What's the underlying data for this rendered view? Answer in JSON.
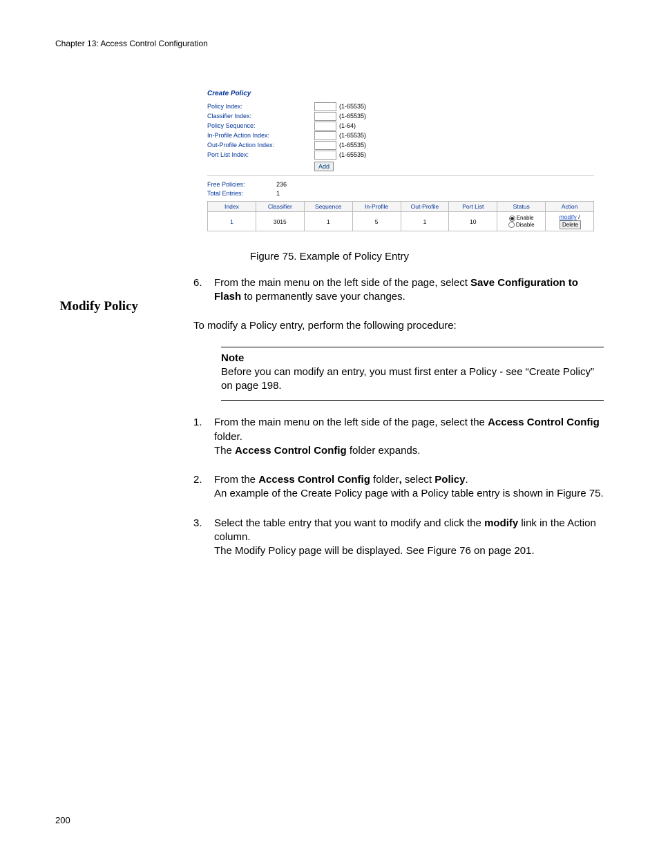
{
  "header": "Chapter 13: Access Control Configuration",
  "screenshot": {
    "title": "Create Policy",
    "fields": [
      {
        "label": "Policy Index:",
        "range": "(1-65535)"
      },
      {
        "label": "Classifier Index:",
        "range": "(1-65535)"
      },
      {
        "label": "Policy Sequence:",
        "range": "(1-64)"
      },
      {
        "label": "In-Profile Action Index:",
        "range": "(1-65535)"
      },
      {
        "label": "Out-Profile Action Index:",
        "range": "(1-65535)"
      },
      {
        "label": "Port List Index:",
        "range": "(1-65535)"
      }
    ],
    "add_button": "Add",
    "stats": [
      {
        "k": "Free Policies:",
        "v": "236"
      },
      {
        "k": "Total Entries:",
        "v": "1"
      }
    ],
    "columns": [
      "Index",
      "Classifier",
      "Sequence",
      "In-Profile",
      "Out-Profile",
      "Port List",
      "Status",
      "Action"
    ],
    "row": {
      "index": "1",
      "classifier": "3015",
      "sequence": "1",
      "inprofile": "5",
      "outprofile": "1",
      "portlist": "10",
      "status_enable": "Enable",
      "status_disable": "Disable",
      "modify": "modify",
      "delete": "Delete"
    }
  },
  "fig_caption": "Figure 75. Example of Policy Entry",
  "step6": {
    "num": "6.",
    "text_a": "From the main menu on the left side of the page, select ",
    "bold_a": "Save Configuration to Flash",
    "text_b": " to permanently save your changes."
  },
  "side_heading": "Modify Policy",
  "intro": "To modify a Policy entry, perform the following procedure:",
  "note": {
    "label": "Note",
    "text": "Before you can modify an entry, you must first enter a Policy - see “Create Policy” on page 198."
  },
  "step1": {
    "num": "1.",
    "t1": "From the main menu on the left side of the page, select the ",
    "b1": "Access Control Config",
    "t2": " folder.",
    "t3": "The ",
    "b2": "Access Control Config",
    "t4": " folder expands."
  },
  "step2": {
    "num": "2.",
    "t1": "From the ",
    "b1": "Access Control Config",
    "t2": " folder",
    "b2": ",",
    "t3": " select ",
    "b3": "Policy",
    "t4": ".",
    "t5": "An example of the Create Policy page with a Policy table entry is shown in Figure 75."
  },
  "step3": {
    "num": "3.",
    "t1": "Select the table entry that you want to modify and click the ",
    "b1": "modify",
    "t2": " link in the Action column.",
    "t3": "The Modify Policy page will be displayed. See Figure 76 on page 201."
  },
  "page_num": "200"
}
